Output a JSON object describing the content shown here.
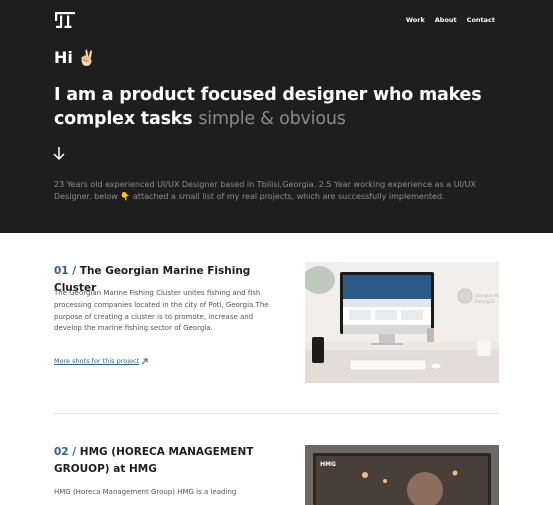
{
  "nav": {
    "logo_icon": "logo-mark-icon",
    "links": [
      "Work",
      "About",
      "Contact"
    ]
  },
  "hero": {
    "greeting": "Hi",
    "greeting_emoji": "✌🏻",
    "headline_main": "I am a product focused designer who makes complex tasks",
    "headline_muted": "simple & obvious",
    "scroll_icon": "arrow-down-icon",
    "intro_before": "23 Years old experienced UI/UX Designer based in Tbilisi,Georgia. 2.5 Year working experience as a UI/UX Designer. below",
    "intro_emoji": "👇",
    "intro_after": "attached a small list of my real projects, which are successfully implemented."
  },
  "projects": [
    {
      "number": "01",
      "title": "The Georgian Marine Fishing Cluster",
      "description": "The Georgian Marine Fishing Cluster unites fishing and fish processing companies located in the city of Poti, Georgia.The purpose of creating a cluster is to promote, increase and develop the marine fishing sector of Georgia.",
      "more_link": "More shots for this project",
      "more_icon": "arrow-up-right-icon"
    },
    {
      "number": "02",
      "title": "HMG (HORECA MANAGEMENT GROUOP) at HMG",
      "description": "HMG (Horeca Management Group) HMG is a leading",
      "image_brand": "HMG"
    }
  ],
  "colors": {
    "hero_bg": "#1f1e1e",
    "accent": "#2f5f86",
    "muted_text": "#8c8c8c"
  }
}
